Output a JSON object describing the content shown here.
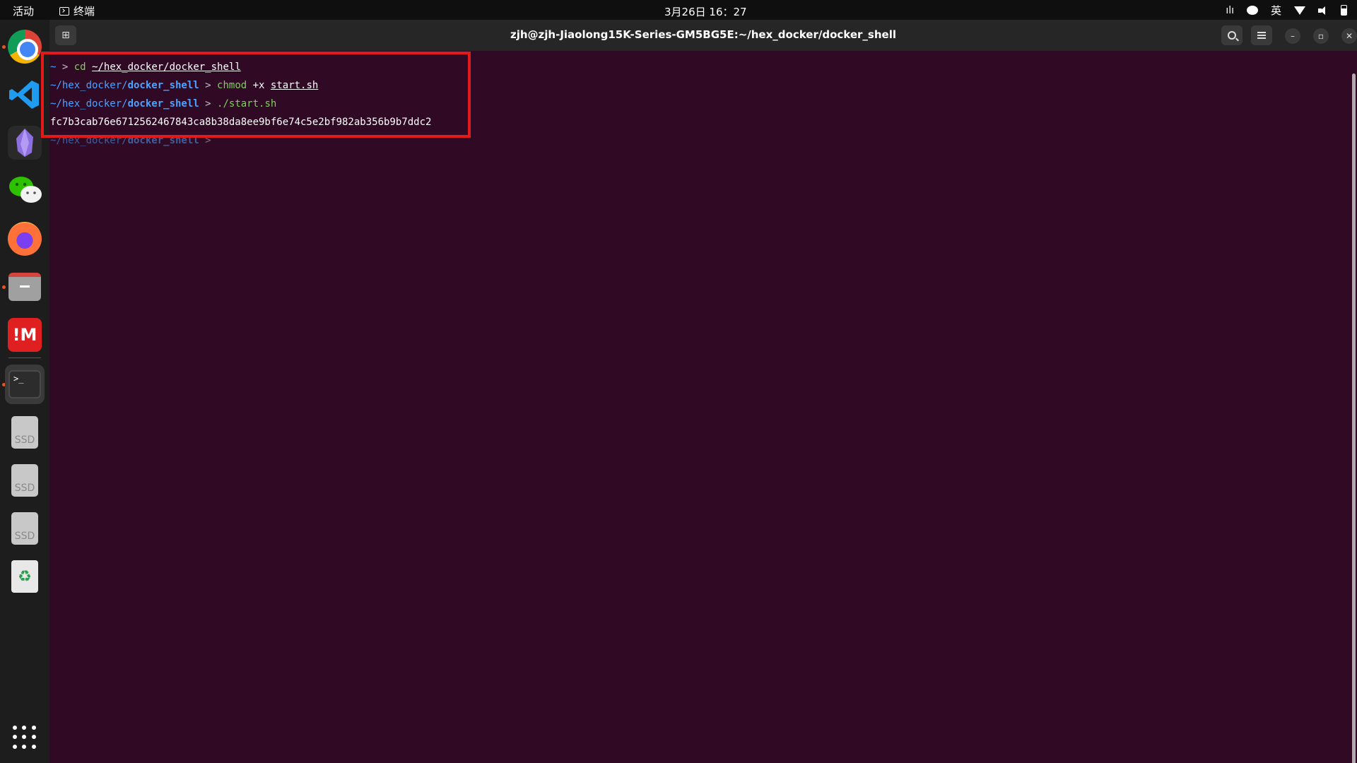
{
  "topbar": {
    "activities": "活动",
    "app_name": "终端",
    "clock": "3月26日  16：27",
    "input_method": "英"
  },
  "dock": {
    "items": [
      {
        "name": "chrome",
        "icon": "chrome-icon"
      },
      {
        "name": "vscode",
        "icon": "vscode-icon"
      },
      {
        "name": "obsidian",
        "icon": "obsidian-icon"
      },
      {
        "name": "wechat",
        "icon": "wechat-icon"
      },
      {
        "name": "firefox",
        "icon": "firefox-icon"
      },
      {
        "name": "files",
        "icon": "files-icon"
      },
      {
        "name": "marginnote",
        "icon": "marginnote-icon",
        "label": "!M"
      },
      {
        "name": "terminal",
        "icon": "terminal-icon",
        "label": ">_"
      },
      {
        "name": "ssd-1",
        "icon": "ssd-icon",
        "label": "SSD"
      },
      {
        "name": "ssd-2",
        "icon": "ssd-icon",
        "label": "SSD"
      },
      {
        "name": "ssd-3",
        "icon": "ssd-icon",
        "label": "SSD"
      },
      {
        "name": "trash",
        "icon": "trash-icon",
        "label": "♻"
      }
    ]
  },
  "window": {
    "title": "zjh@zjh-Jiaolong15K-Series-GM5BG5E:~/hex_docker/docker_shell",
    "new_tab_glyph": "⊞",
    "minimize_glyph": "–",
    "maximize_glyph": "▫",
    "close_glyph": "✕"
  },
  "terminal": {
    "line1": {
      "prompt_dir": "~",
      "arrow": " > ",
      "cmd": "cd ",
      "arg": "~/hex_docker/docker_shell"
    },
    "line2": {
      "prompt_dir": "~/hex_docker/",
      "prompt_bold": "docker_shell",
      "arrow": " > ",
      "cmd": "chmod",
      "arg1": " +x ",
      "arg2": "start.sh"
    },
    "line3": {
      "prompt_dir": "~/hex_docker/",
      "prompt_bold": "docker_shell",
      "arrow": " > ",
      "cmd": "./start.sh"
    },
    "line4": {
      "output": "fc7b3cab76e6712562467843ca8b38da8ee9bf6e74c5e2bf982ab356b9b7ddc2"
    },
    "line5": {
      "prompt_dir": "~/hex_docker/",
      "prompt_bold": "docker_shell",
      "arrow": " > "
    }
  },
  "colors": {
    "terminal_bg": "#300a24",
    "prompt_blue": "#4aa3ff",
    "command_green": "#7fcf5f",
    "highlight_red": "#e21a1a",
    "ubuntu_orange": "#e95420"
  }
}
